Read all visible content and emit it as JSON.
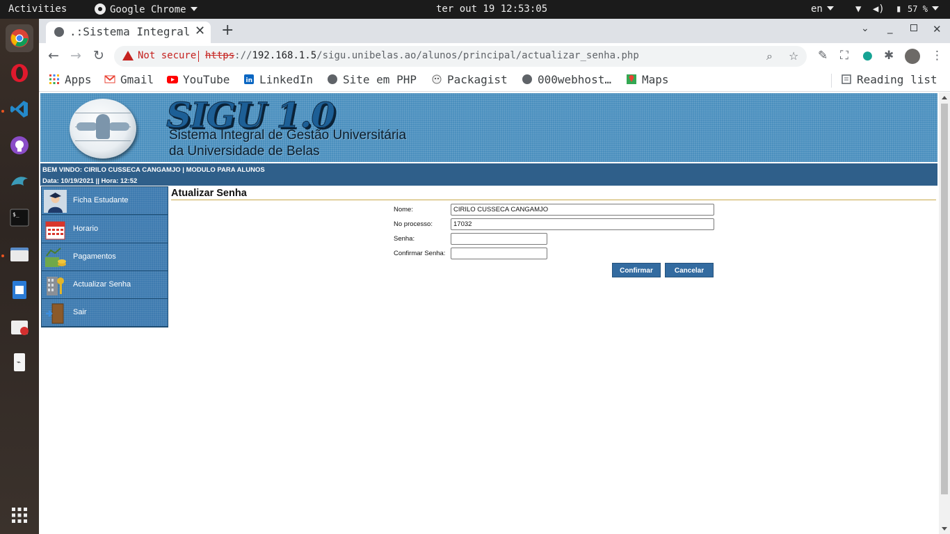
{
  "desktop": {
    "activities": "Activities",
    "app_menu": "Google Chrome",
    "clock": "ter out 19 12:53:05",
    "language": "en",
    "battery": "57 %"
  },
  "browser": {
    "tab_title": ".:Sistema Integral de Gestão Universitária:.",
    "not_secure": "Not secure",
    "url_scheme": "https",
    "url_sep": "://",
    "url_host": "192.168.1.5",
    "url_path": "/sigu.unibelas.ao/alunos/principal/actualizar_senha.php",
    "bookmarks": [
      {
        "label": "Apps"
      },
      {
        "label": "Gmail"
      },
      {
        "label": "YouTube"
      },
      {
        "label": "LinkedIn"
      },
      {
        "label": "Site em PHP"
      },
      {
        "label": "Packagist"
      },
      {
        "label": "000webhost…"
      },
      {
        "label": "Maps"
      }
    ],
    "reading_list": "Reading list"
  },
  "header": {
    "title": "SIGU 1.0",
    "subtitle_1": "Sistema Integral de Gestão Universitária",
    "subtitle_2": "da Universidade de Belas"
  },
  "welcome": {
    "line1": "BEM VINDO: CIRILO CUSSECA CANGAMJO  | MODULO PARA ALUNOS",
    "line2": "Data: 10/19/2021 || Hora: 12:52"
  },
  "menu": [
    {
      "label": "Ficha Estudante",
      "icon": "student-icon"
    },
    {
      "label": "Horario",
      "icon": "calendar-icon"
    },
    {
      "label": "Pagamentos",
      "icon": "money-icon"
    },
    {
      "label": "Actualizar Senha",
      "icon": "keys-icon"
    },
    {
      "label": "Sair",
      "icon": "exit-door-icon"
    }
  ],
  "form": {
    "title": "Atualizar Senha",
    "nome_label": "Nome:",
    "nome_value": "CIRILO CUSSECA CANGAMJO",
    "processo_label": "No processo:",
    "processo_value": "17032",
    "senha_label": "Senha:",
    "senha_value": "",
    "confirmar_label": "Confirmar Senha:",
    "confirmar_value": "",
    "confirm_button": "Confirmar",
    "cancel_button": "Cancelar"
  },
  "colors": {
    "banner": "#4a8fbe",
    "welcome_bar": "#2f5f8a",
    "menu_bg": "#3e7bb0",
    "button": "#336ba0",
    "title_rule": "#c8a84a"
  }
}
